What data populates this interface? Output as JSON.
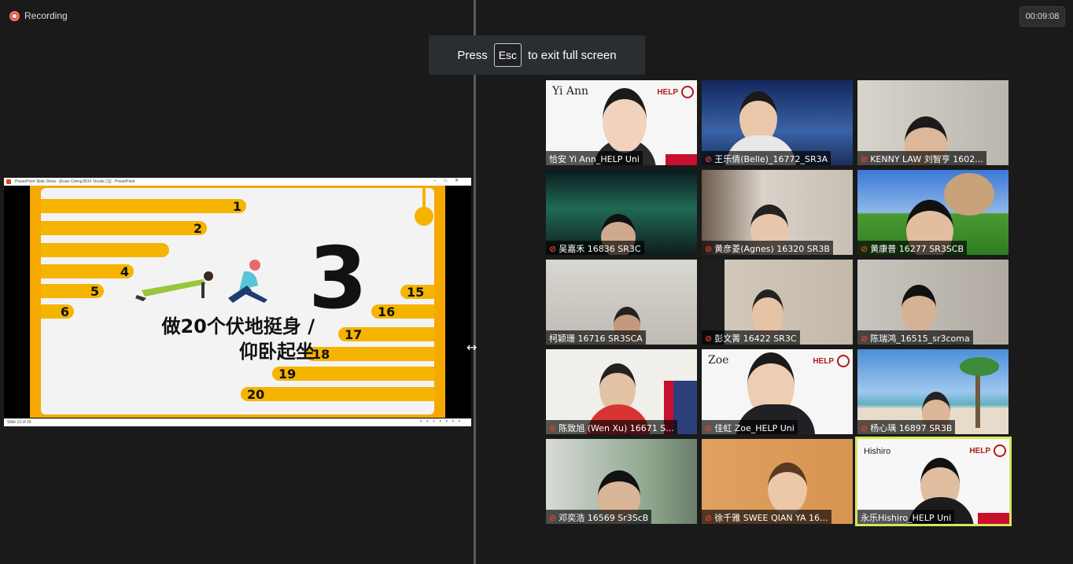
{
  "recording_label": "Recording",
  "timer": "00:09:08",
  "esc_banner": {
    "press": "Press",
    "key": "Esc",
    "rest": "to exit full screen"
  },
  "resize_icon": "resize-horizontal-icon",
  "share": {
    "window_title": "PowerPoint Slide Show - [Kuan Cheng BOX Vocals (1)] - PowerPoint",
    "status_text": "Slide 13 of 30",
    "slide": {
      "big_number": "3",
      "task_line1": "做20个伏地挺身 /",
      "task_line2": "仰卧起坐",
      "left_bars": [
        "1",
        "2",
        "",
        "4",
        "5",
        "6"
      ],
      "right_bars": [
        "15",
        "16",
        "17",
        "18",
        "19",
        "20"
      ]
    }
  },
  "participants": [
    {
      "name": "恰安  Yi Ann_HELP Uni",
      "muted": false,
      "top_label": "Yi Ann"
    },
    {
      "name": "王乐倩(Belle)_16772_SR3A",
      "muted": true
    },
    {
      "name": "KENNY LAW  刘智亨  1602...",
      "muted": true
    },
    {
      "name": "吴嘉禾  16836 SR3C",
      "muted": true
    },
    {
      "name": "黄彦菱(Agnes) 16320 SR3B",
      "muted": true
    },
    {
      "name": "黄康普  16277 SR3SCB",
      "muted": true
    },
    {
      "name": "柯颖珊  16716 SR3SCA",
      "muted": false
    },
    {
      "name": "彭文菁  16422 SR3C",
      "muted": true
    },
    {
      "name": "陈瑞鸿_16515_sr3coma",
      "muted": true
    },
    {
      "name": "陈致旭 (Wen Xu) 16671 S...",
      "muted": true
    },
    {
      "name": "佳虹  Zoe_HELP Uni",
      "muted": false,
      "top_label": "Zoe"
    },
    {
      "name": "杨心瑀  16897 SR3B",
      "muted": true
    },
    {
      "name": "邓奕浩  16569 Sr3ScB",
      "muted": true
    },
    {
      "name": "徐千雅 SWEE QIAN YA 16...",
      "muted": true
    },
    {
      "name": "永乐Hishiro_HELP Uni",
      "muted": false,
      "top_label": "Hishiro",
      "active": true
    }
  ]
}
